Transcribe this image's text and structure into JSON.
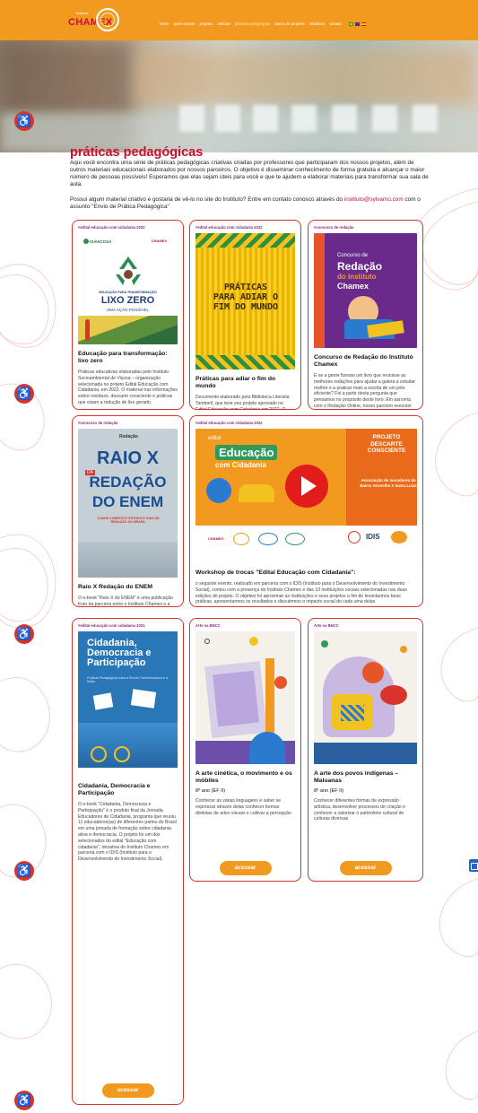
{
  "header": {
    "logo_small": "instituto",
    "logo_text": "CHAMEX",
    "nav": [
      {
        "label": "home"
      },
      {
        "label": "quem somos"
      },
      {
        "label": "projetos"
      },
      {
        "label": "notícias"
      },
      {
        "label": "práticas pedagógicas"
      },
      {
        "label": "banco de projetos"
      },
      {
        "label": "relatórios"
      },
      {
        "label": "contato"
      }
    ],
    "active_nav": "práticas pedagógicas"
  },
  "page": {
    "title": "práticas pedagógicas",
    "intro": "Aqui você encontra uma série de práticas pedagógicas criativas criadas por professores que participaram dos nossos projetos, além de outros materiais educacionais elaborados por nossos parceiros. O objetivo é disseminar conhecimento de forma gratuita e alcançar o maior número de pessoas possíveis! Esperamos que elas sejam úteis para você e que te ajudem a elaborar materiais para transformar sua sala de aula.",
    "intro2_before": "Possui algum material criativo e gostaria de vê-lo no site do Instituto? Entre em contato conosco através do ",
    "intro2_link": "instituto@sylvamo.com",
    "intro2_after": " com o assunto \"Envio de Prática Pedagógica\""
  },
  "cards": [
    {
      "tag": "#edital educação com cidadania 2022",
      "image_partner": "ISAVICOSA",
      "image_title": "LIXO ZERO",
      "image_sub": "UMA AÇÃO POSSÍVEL",
      "image_kicker": "EDUCAÇÃO PARA TRANSFORMAÇÃO",
      "title": "Educação para transformação: lixo zero",
      "text": "Práticas educativas elaboradas pelo Instituto Socioambiental de Viçosa – organização selecionada no projeto Edital Educação com Cidadania, em 2022. O material traz informações sobre resíduos, descarte consciente e práticas que visam a redução de lixo gerado.",
      "button": "acessar"
    },
    {
      "tag": "#edital educação com cidadania 2022",
      "image_title": "PRÁTICAS PARA ADIAR O FIM DO MUNDO",
      "title": "Práticas para adiar o fim do mundo",
      "text": "Documento elaborado pela Biblioteca Literária Tamboril, que teve seu projeto aprovado no Edital Educação com Cidadania em 2022. O material tem como objetivo apresentar a potência da literatura indígena como instrumento capaz de promover a reancestralização e a nossa reconexão com a mãe terra.",
      "button": "acessar"
    },
    {
      "tag": "#concurso de redação",
      "image_line1": "Concurso de",
      "image_line2": "Redação",
      "image_line3": "do Instituto",
      "image_line4": "Chamex",
      "title": "Concurso de Redação do Instituto Chamex",
      "text": "E se a gente fizesse um livro que reunisse as melhores redações para ajudar a galera a estudar melhor e a praticar mais a escrita de um jeito eficiente? Foi a partir desta pergunta que pensamos no propósito deste livro. Em parceria com o Redação Online, nosso parceiro executor do projeto \"Concurso de Redação\" – projeto que tem como foco preparar alunos do ensino público para o Exame Nacional do Ensino Médio (Enem) e, assim, aumentar as chances de ingresso em uma universidade –, selecionamos as melhores redações de 2019 e 2020 e reunimos neste 1º edição, que conta também com a história do Concurso, da parceria com o Instituto, além de dicas para melhorar a escrita e a leitura pensando na prova de redação do ENEM.",
      "button": "acessar"
    },
    {
      "tag": "#concurso de redação",
      "image_brand": "Redação",
      "image_line1": "RAIO X",
      "image_line2": "DA",
      "image_line3": "REDAÇÃO",
      "image_line4": "DO ENEM",
      "image_sub": "O MAIS COMPLETO ESTUDO E GUIA DE REDAÇÃO DO BRASIL",
      "title": "Raio X Redação do ENEM",
      "text": "O e-book \"Raio X do ENEM\" é uma publicação fruto da parceria entre o Instituto Chamex e a Redação Online. Aqui, você encontra informações sobre a prova, sua estrutura e critérios de avaliação com foco na redação. Além disso, há também uma série de dicas para melhorar a sua escrita e desempenho em geral.",
      "button": "acessar"
    },
    {
      "tag": "#edital educação com cidadania 2022",
      "video_edital": "edital",
      "video_title1": "Educação",
      "video_title2": "com Cidadania",
      "video_right1": "PROJETO",
      "video_right2": "DESCARTE",
      "video_right3": "CONSCIENTE",
      "video_assoc": "Associação de moradores do Bairro Vermelho e Santa Luiza",
      "video_idis": "IDIS",
      "title": "Workshop de trocas \"Edital Educação com Cidadania\":",
      "text": "o seguinte evento, realizado em parceria com o IDIS (Instituto para o Desenvolvimento do Investimento Social), contou com a presença do Instituto Chamex e das 10 instituições sociais selecionadas nas duas edições do projeto. O objetivo foi aproximar as instituições e seus projetos a fim de levantarmos boas práticas, apresentarmos os resultados e discutirmos o impacto social do cada uma delas.",
      "button": "acessar"
    },
    {
      "tag": "#edital educação com cidadania 2021",
      "image_title": "Cidadania, Democracia e Participação",
      "image_sub": "Práticas Pedagógicas para a Escola Transformadora e a Mídia",
      "title": "Cidadania, Democracia e Participação",
      "text": "O e-book \"Cidadania, Democracia e Participação\" é o produto final da Jornada Educadores de Cidadania, programa que reuniu 11 educadores(as) de diferentes partes do Brasil em uma jornada de formação sobre cidadania ativa e democracia. O projeto foi um dos selecionados do edital \"Educação com cidadania\", iniciativa do Instituto Chamex em parceria com o IDIS (Instituto para o Desenvolvimento do Investimento Social).",
      "button": "acessar"
    },
    {
      "tag": "Arte na BNCC",
      "title": "A arte cinética, o movimento e os móbiles",
      "sub": "8º ano (EF II)",
      "text": "Conhecer as várias linguagens e saber se expressar através delas conhecer formas distintas de artes visuais e cultivar a percepção",
      "button": "acessar"
    },
    {
      "tag": "Arte na BNCC",
      "title": "A arte dos povos indígenas – Maluanas",
      "sub": "8º ano (EF II)",
      "text": "Conhecer diferentes formas de expressão artística, desenvolver processos de criação e conhecer a valorizar o patrimônio cultural de culturas diversas",
      "button": "acessar"
    }
  ],
  "colors": {
    "orange": "#f29a1f",
    "red": "#d9342b",
    "purple": "#8b2a7a"
  }
}
